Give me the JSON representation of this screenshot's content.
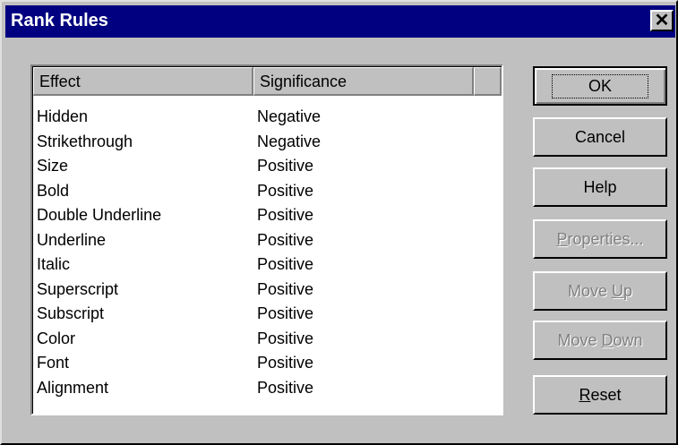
{
  "window": {
    "title": "Rank Rules",
    "close_label": "✕"
  },
  "list": {
    "columns": [
      "Effect",
      "Significance"
    ],
    "rows": [
      {
        "effect": "Hidden",
        "significance": "Negative"
      },
      {
        "effect": "Strikethrough",
        "significance": "Negative"
      },
      {
        "effect": "Size",
        "significance": "Positive"
      },
      {
        "effect": "Bold",
        "significance": "Positive"
      },
      {
        "effect": "Double Underline",
        "significance": "Positive"
      },
      {
        "effect": "Underline",
        "significance": "Positive"
      },
      {
        "effect": "Italic",
        "significance": "Positive"
      },
      {
        "effect": "Superscript",
        "significance": "Positive"
      },
      {
        "effect": "Subscript",
        "significance": "Positive"
      },
      {
        "effect": "Color",
        "significance": "Positive"
      },
      {
        "effect": "Font",
        "significance": "Positive"
      },
      {
        "effect": "Alignment",
        "significance": "Positive"
      }
    ]
  },
  "buttons": {
    "ok": "OK",
    "cancel": "Cancel",
    "help": "Help",
    "properties": {
      "mnemonic": "P",
      "rest": "roperties..."
    },
    "move_up": {
      "pre": "Move ",
      "mnemonic": "U",
      "rest": "p"
    },
    "move_down": {
      "pre": "Move ",
      "mnemonic": "D",
      "rest": "own"
    },
    "reset": {
      "mnemonic": "R",
      "rest": "eset"
    }
  }
}
